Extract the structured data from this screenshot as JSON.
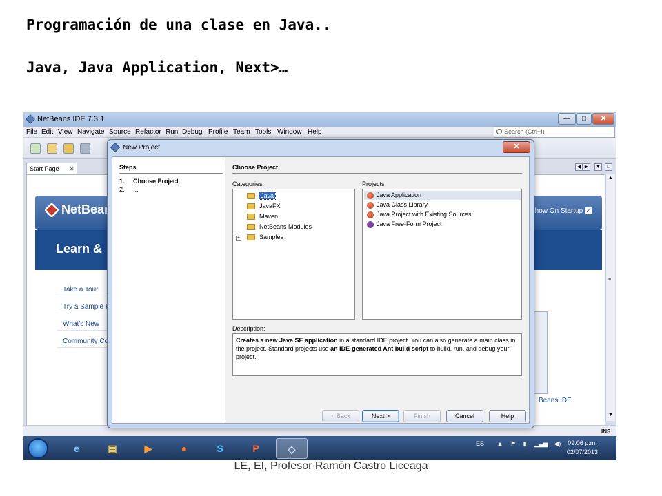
{
  "slide": {
    "title": "Programación de una clase en Java..",
    "subtitle": "Java, Java Application, Next>…",
    "footer": "LE, EI, Profesor Ramón Castro Liceaga"
  },
  "ide": {
    "window_title": "NetBeans IDE 7.3.1",
    "window_buttons": [
      "—",
      "□",
      "✕"
    ],
    "menu": [
      "File",
      "Edit",
      "View",
      "Navigate",
      "Source",
      "Refactor",
      "Run",
      "Debug",
      "Profile",
      "Team",
      "Tools",
      "Window",
      "Help"
    ],
    "search_placeholder": "Search (Ctrl+I)",
    "tab_label": "Start Page",
    "tab_close": "⊠",
    "start_page": {
      "logo_text": "NetBeans",
      "learn_text": "Learn &",
      "show_on_startup": "Show On Startup",
      "show_on_startup_checked": "✓",
      "links": [
        "Take a Tour",
        "Try a Sample P",
        "What's New",
        "Community Co"
      ],
      "bottom_text": "Beans IDE"
    },
    "status_ins": "INS"
  },
  "dialog": {
    "title": "New Project",
    "close": "✕",
    "steps_title": "Steps",
    "steps": [
      {
        "num": "1.",
        "label": "Choose Project",
        "bold": true
      },
      {
        "num": "2.",
        "label": "...",
        "bold": false
      }
    ],
    "choose_title": "Choose Project",
    "categories_label": "Categories:",
    "categories": [
      {
        "label": "Java",
        "selected": true,
        "expandable": false
      },
      {
        "label": "JavaFX",
        "selected": false,
        "expandable": false
      },
      {
        "label": "Maven",
        "selected": false,
        "expandable": false
      },
      {
        "label": "NetBeans Modules",
        "selected": false,
        "expandable": false
      },
      {
        "label": "Samples",
        "selected": false,
        "expandable": true
      }
    ],
    "projects_label": "Projects:",
    "projects": [
      {
        "label": "Java Application",
        "selected": true
      },
      {
        "label": "Java Class Library",
        "selected": false
      },
      {
        "label": "Java Project with Existing Sources",
        "selected": false
      },
      {
        "label": "Java Free-Form Project",
        "selected": false
      }
    ],
    "description_label": "Description:",
    "description": {
      "p1_bold": "Creates a new Java SE application",
      "p1_rest": " in a standard IDE project. You can also generate a main class in the project. Standard projects use ",
      "p2_bold": "an IDE-generated Ant build script",
      "p2_rest": " to build, run, and debug your project."
    },
    "buttons": {
      "back": "< Back",
      "next": "Next >",
      "finish": "Finish",
      "cancel": "Cancel",
      "help": "Help"
    }
  },
  "taskbar": {
    "apps": [
      "IE",
      "Explorer",
      "Media",
      "Firefox",
      "Skype",
      "PowerPoint",
      "NetBeans"
    ],
    "lang": "ES",
    "time": "09:06 p.m.",
    "date": "02/07/2013"
  }
}
